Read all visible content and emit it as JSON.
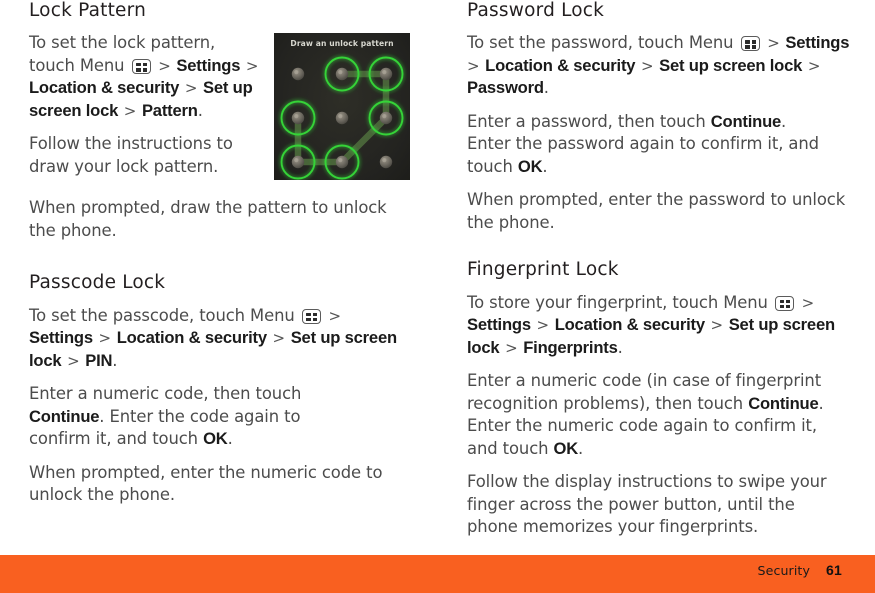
{
  "footer": {
    "section": "Security",
    "page": "61",
    "bar_color": "#f96020"
  },
  "icons": {
    "menu": "menu-grid-icon"
  },
  "left_column": {
    "sections": [
      {
        "heading": "Lock Pattern",
        "paragraphs": [
          {
            "id": "lock-pattern-path",
            "runs": [
              {
                "t": "To set the lock pattern, touch Menu ",
                "s": "n"
              },
              {
                "t": "MENU_ICON",
                "s": "icon"
              },
              {
                "t": " > ",
                "s": "chev"
              },
              {
                "t": "Settings",
                "s": "b"
              },
              {
                "t": " > ",
                "s": "chev"
              },
              {
                "t": "Location & security",
                "s": "b"
              },
              {
                "t": " > ",
                "s": "chev"
              },
              {
                "t": "Set up screen lock",
                "s": "b"
              },
              {
                "t": " > ",
                "s": "chev"
              },
              {
                "t": "Pattern",
                "s": "b"
              },
              {
                "t": ".",
                "s": "n"
              }
            ]
          },
          {
            "id": "lock-pattern-follow",
            "runs": [
              {
                "t": "Follow the instructions to draw your lock pattern.",
                "s": "n"
              }
            ]
          },
          {
            "id": "lock-pattern-prompt",
            "runs": [
              {
                "t": "When prompted, draw the pattern to unlock the phone.",
                "s": "n"
              }
            ]
          }
        ]
      },
      {
        "heading": "Passcode Lock",
        "paragraphs": [
          {
            "id": "passcode-path",
            "runs": [
              {
                "t": "To set the passcode, touch Menu ",
                "s": "n"
              },
              {
                "t": "MENU_ICON",
                "s": "icon"
              },
              {
                "t": " > ",
                "s": "chev"
              },
              {
                "t": "Settings",
                "s": "b"
              },
              {
                "t": " > ",
                "s": "chev"
              },
              {
                "t": "Location & security",
                "s": "b"
              },
              {
                "t": " > ",
                "s": "chev"
              },
              {
                "t": "Set up screen lock",
                "s": "b"
              },
              {
                "t": " > ",
                "s": "chev"
              },
              {
                "t": "PIN",
                "s": "b"
              },
              {
                "t": ".",
                "s": "n"
              }
            ]
          },
          {
            "id": "passcode-enter",
            "runs": [
              {
                "t": "Enter a numeric code, then touch ",
                "s": "n"
              },
              {
                "t": "Continue",
                "s": "b"
              },
              {
                "t": ". Enter the code again to confirm it, and touch ",
                "s": "n"
              },
              {
                "t": "OK",
                "s": "b"
              },
              {
                "t": ".",
                "s": "n"
              }
            ]
          },
          {
            "id": "passcode-prompt",
            "runs": [
              {
                "t": "When prompted, enter the numeric code to unlock the phone.",
                "s": "n"
              }
            ]
          }
        ]
      }
    ]
  },
  "right_column": {
    "sections": [
      {
        "heading": "Password Lock",
        "paragraphs": [
          {
            "id": "password-path",
            "runs": [
              {
                "t": "To set the password, touch Menu ",
                "s": "n"
              },
              {
                "t": "MENU_ICON",
                "s": "icon"
              },
              {
                "t": " > ",
                "s": "chev"
              },
              {
                "t": "Settings",
                "s": "b"
              },
              {
                "t": " > ",
                "s": "chev"
              },
              {
                "t": "Location & security",
                "s": "b"
              },
              {
                "t": " > ",
                "s": "chev"
              },
              {
                "t": "Set up screen lock",
                "s": "b"
              },
              {
                "t": " > ",
                "s": "chev"
              },
              {
                "t": "Password",
                "s": "b"
              },
              {
                "t": ".",
                "s": "n"
              }
            ]
          },
          {
            "id": "password-enter",
            "runs": [
              {
                "t": "Enter a password, then touch ",
                "s": "n"
              },
              {
                "t": "Continue",
                "s": "b"
              },
              {
                "t": ". Enter the password again to confirm it, and touch ",
                "s": "n"
              },
              {
                "t": "OK",
                "s": "b"
              },
              {
                "t": ".",
                "s": "n"
              }
            ]
          },
          {
            "id": "password-prompt",
            "runs": [
              {
                "t": "When prompted, enter the password to unlock the phone.",
                "s": "n"
              }
            ]
          }
        ]
      },
      {
        "heading": "Fingerprint Lock",
        "paragraphs": [
          {
            "id": "fingerprint-path",
            "runs": [
              {
                "t": "To store your fingerprint, touch Menu ",
                "s": "n"
              },
              {
                "t": "MENU_ICON",
                "s": "icon"
              },
              {
                "t": " > ",
                "s": "chev"
              },
              {
                "t": "Settings",
                "s": "b"
              },
              {
                "t": " > ",
                "s": "chev"
              },
              {
                "t": "Location & security",
                "s": "b"
              },
              {
                "t": " > ",
                "s": "chev"
              },
              {
                "t": "Set up screen lock",
                "s": "b"
              },
              {
                "t": " > ",
                "s": "chev"
              },
              {
                "t": "Fingerprints",
                "s": "b"
              },
              {
                "t": ".",
                "s": "n"
              }
            ]
          },
          {
            "id": "fingerprint-enter",
            "runs": [
              {
                "t": "Enter a numeric code (in case of fingerprint recognition problems), then touch ",
                "s": "n"
              },
              {
                "t": "Continue",
                "s": "b"
              },
              {
                "t": ". Enter the numeric code again to confirm it, and touch ",
                "s": "n"
              },
              {
                "t": "OK",
                "s": "b"
              },
              {
                "t": ".",
                "s": "n"
              }
            ]
          },
          {
            "id": "fingerprint-follow",
            "runs": [
              {
                "t": "Follow the display instructions to swipe your finger across the power button, until the phone memorizes your fingerprints.",
                "s": "n"
              }
            ]
          }
        ]
      }
    ]
  },
  "pattern_screenshot": {
    "title": "Draw an unlock pattern",
    "background_color": "#262622",
    "ring_color": "#35d437",
    "dot_color": "#6e6a61",
    "trail_color": "#4d6b3c",
    "grid_dots": [
      {
        "r": 0,
        "c": 0,
        "selected": false
      },
      {
        "r": 0,
        "c": 1,
        "selected": true
      },
      {
        "r": 0,
        "c": 2,
        "selected": true
      },
      {
        "r": 1,
        "c": 0,
        "selected": true
      },
      {
        "r": 1,
        "c": 1,
        "selected": false
      },
      {
        "r": 1,
        "c": 2,
        "selected": true
      },
      {
        "r": 2,
        "c": 0,
        "selected": true
      },
      {
        "r": 2,
        "c": 1,
        "selected": true
      },
      {
        "r": 2,
        "c": 2,
        "selected": false
      }
    ],
    "path": [
      {
        "r": 0,
        "c": 1
      },
      {
        "r": 0,
        "c": 2
      },
      {
        "r": 1,
        "c": 2
      },
      {
        "r": 2,
        "c": 1
      },
      {
        "r": 2,
        "c": 0
      },
      {
        "r": 1,
        "c": 0
      }
    ]
  }
}
